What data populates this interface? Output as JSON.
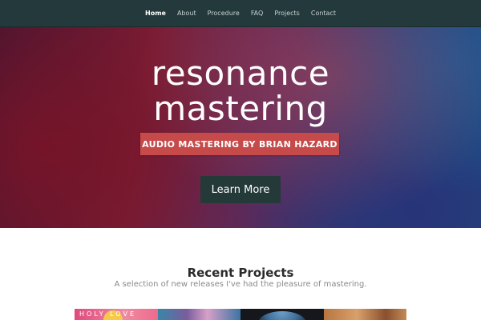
{
  "nav": {
    "items": [
      {
        "label": "Home",
        "active": true
      },
      {
        "label": "About",
        "active": false
      },
      {
        "label": "Procedure",
        "active": false
      },
      {
        "label": "FAQ",
        "active": false
      },
      {
        "label": "Projects",
        "active": false
      },
      {
        "label": "Contact",
        "active": false
      }
    ]
  },
  "hero": {
    "title_line1": "resonance",
    "title_line2": "mastering",
    "subtitle": "AUDIO MASTERING BY BRIAN HAZARD",
    "cta_label": "Learn More"
  },
  "recent": {
    "title": "Recent Projects",
    "subtitle": "A selection of new releases I've had the pleasure of mastering.",
    "first_thumb_text": "HOLY LOVE"
  },
  "colors": {
    "nav_bg": "#23393b",
    "subtitle_bg": "#c64a4a",
    "cta_bg": "#243a39"
  }
}
